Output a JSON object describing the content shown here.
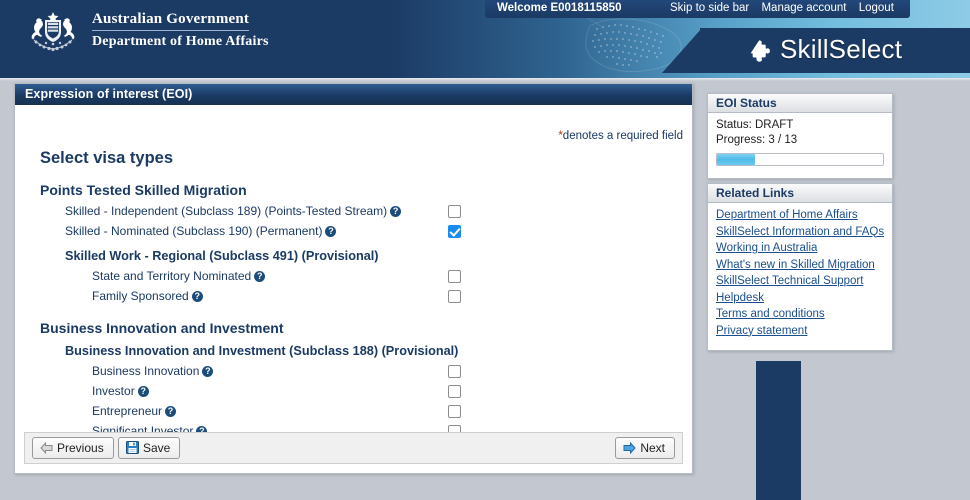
{
  "banner": {
    "gov_line1": "Australian Government",
    "gov_line2": "Department of Home Affairs",
    "crest_icon": "australian-coat-of-arms",
    "map_icon": "australia-dotted-map",
    "app_title": "SkillSelect",
    "app_icon": "puzzle-piece-icon",
    "colors": {
      "navy": "#1b3a64",
      "sky": "#8ecbe6"
    }
  },
  "utility_nav": {
    "welcome": "Welcome E0018115850",
    "links": [
      {
        "label": "Skip to side bar"
      },
      {
        "label": "Manage account"
      },
      {
        "label": "Logout"
      }
    ]
  },
  "panel": {
    "title": "Expression of interest (EOI)",
    "required_note_star": "*",
    "required_note": "denotes a required field",
    "heading": "Select visa types",
    "sections": [
      {
        "heading": "Points Tested Skilled Migration",
        "level": 1,
        "rows": [
          {
            "label": "Skilled - Independent (Subclass 189) (Points-Tested Stream)",
            "help": "?",
            "checked": false,
            "indent": 1
          },
          {
            "label": "Skilled - Nominated (Subclass 190) (Permanent)",
            "help": "?",
            "checked": true,
            "indent": 1
          }
        ]
      },
      {
        "heading": "Skilled Work - Regional (Subclass 491) (Provisional)",
        "level": 2,
        "rows": [
          {
            "label": "State and Territory Nominated",
            "help": "?",
            "checked": false,
            "indent": 2
          },
          {
            "label": "Family Sponsored",
            "help": "?",
            "checked": false,
            "indent": 2
          }
        ]
      },
      {
        "heading": "Business Innovation and Investment",
        "level": 1,
        "rows": []
      },
      {
        "heading": "Business Innovation and Investment (Subclass 188) (Provisional)",
        "level": 2,
        "rows": [
          {
            "label": "Business Innovation",
            "help": "?",
            "checked": false,
            "indent": 2
          },
          {
            "label": "Investor",
            "help": "?",
            "checked": false,
            "indent": 2
          },
          {
            "label": "Entrepreneur",
            "help": "?",
            "checked": false,
            "indent": 2
          },
          {
            "label": "Significant Investor",
            "help": "?",
            "checked": false,
            "indent": 2
          }
        ]
      }
    ],
    "buttons": {
      "previous": {
        "label": "Previous",
        "icon": "arrow-left-icon"
      },
      "save": {
        "label": "Save",
        "icon": "floppy-disk-icon"
      },
      "next": {
        "label": "Next",
        "icon": "arrow-right-icon"
      }
    }
  },
  "sidebar": {
    "status_box": {
      "title": "EOI Status",
      "status_line": "Status: DRAFT",
      "progress_line": "Progress: 3 / 13",
      "progress_current": 3,
      "progress_total": 13,
      "progress_percent": 23,
      "progress_color": "#4fbbe8"
    },
    "links_box": {
      "title": "Related Links",
      "links": [
        {
          "label": "Department of Home Affairs",
          "wrap": false
        },
        {
          "label": "SkillSelect Information and FAQs",
          "wrap": false
        },
        {
          "label": "Working in Australia",
          "wrap": false
        },
        {
          "label": "What's new in Skilled Migration",
          "wrap": false
        },
        {
          "label": "SkillSelect Technical Support Helpdesk",
          "wrap": true
        },
        {
          "label": "Terms and conditions",
          "wrap": false
        },
        {
          "label": "Privacy statement",
          "wrap": false
        }
      ]
    }
  }
}
